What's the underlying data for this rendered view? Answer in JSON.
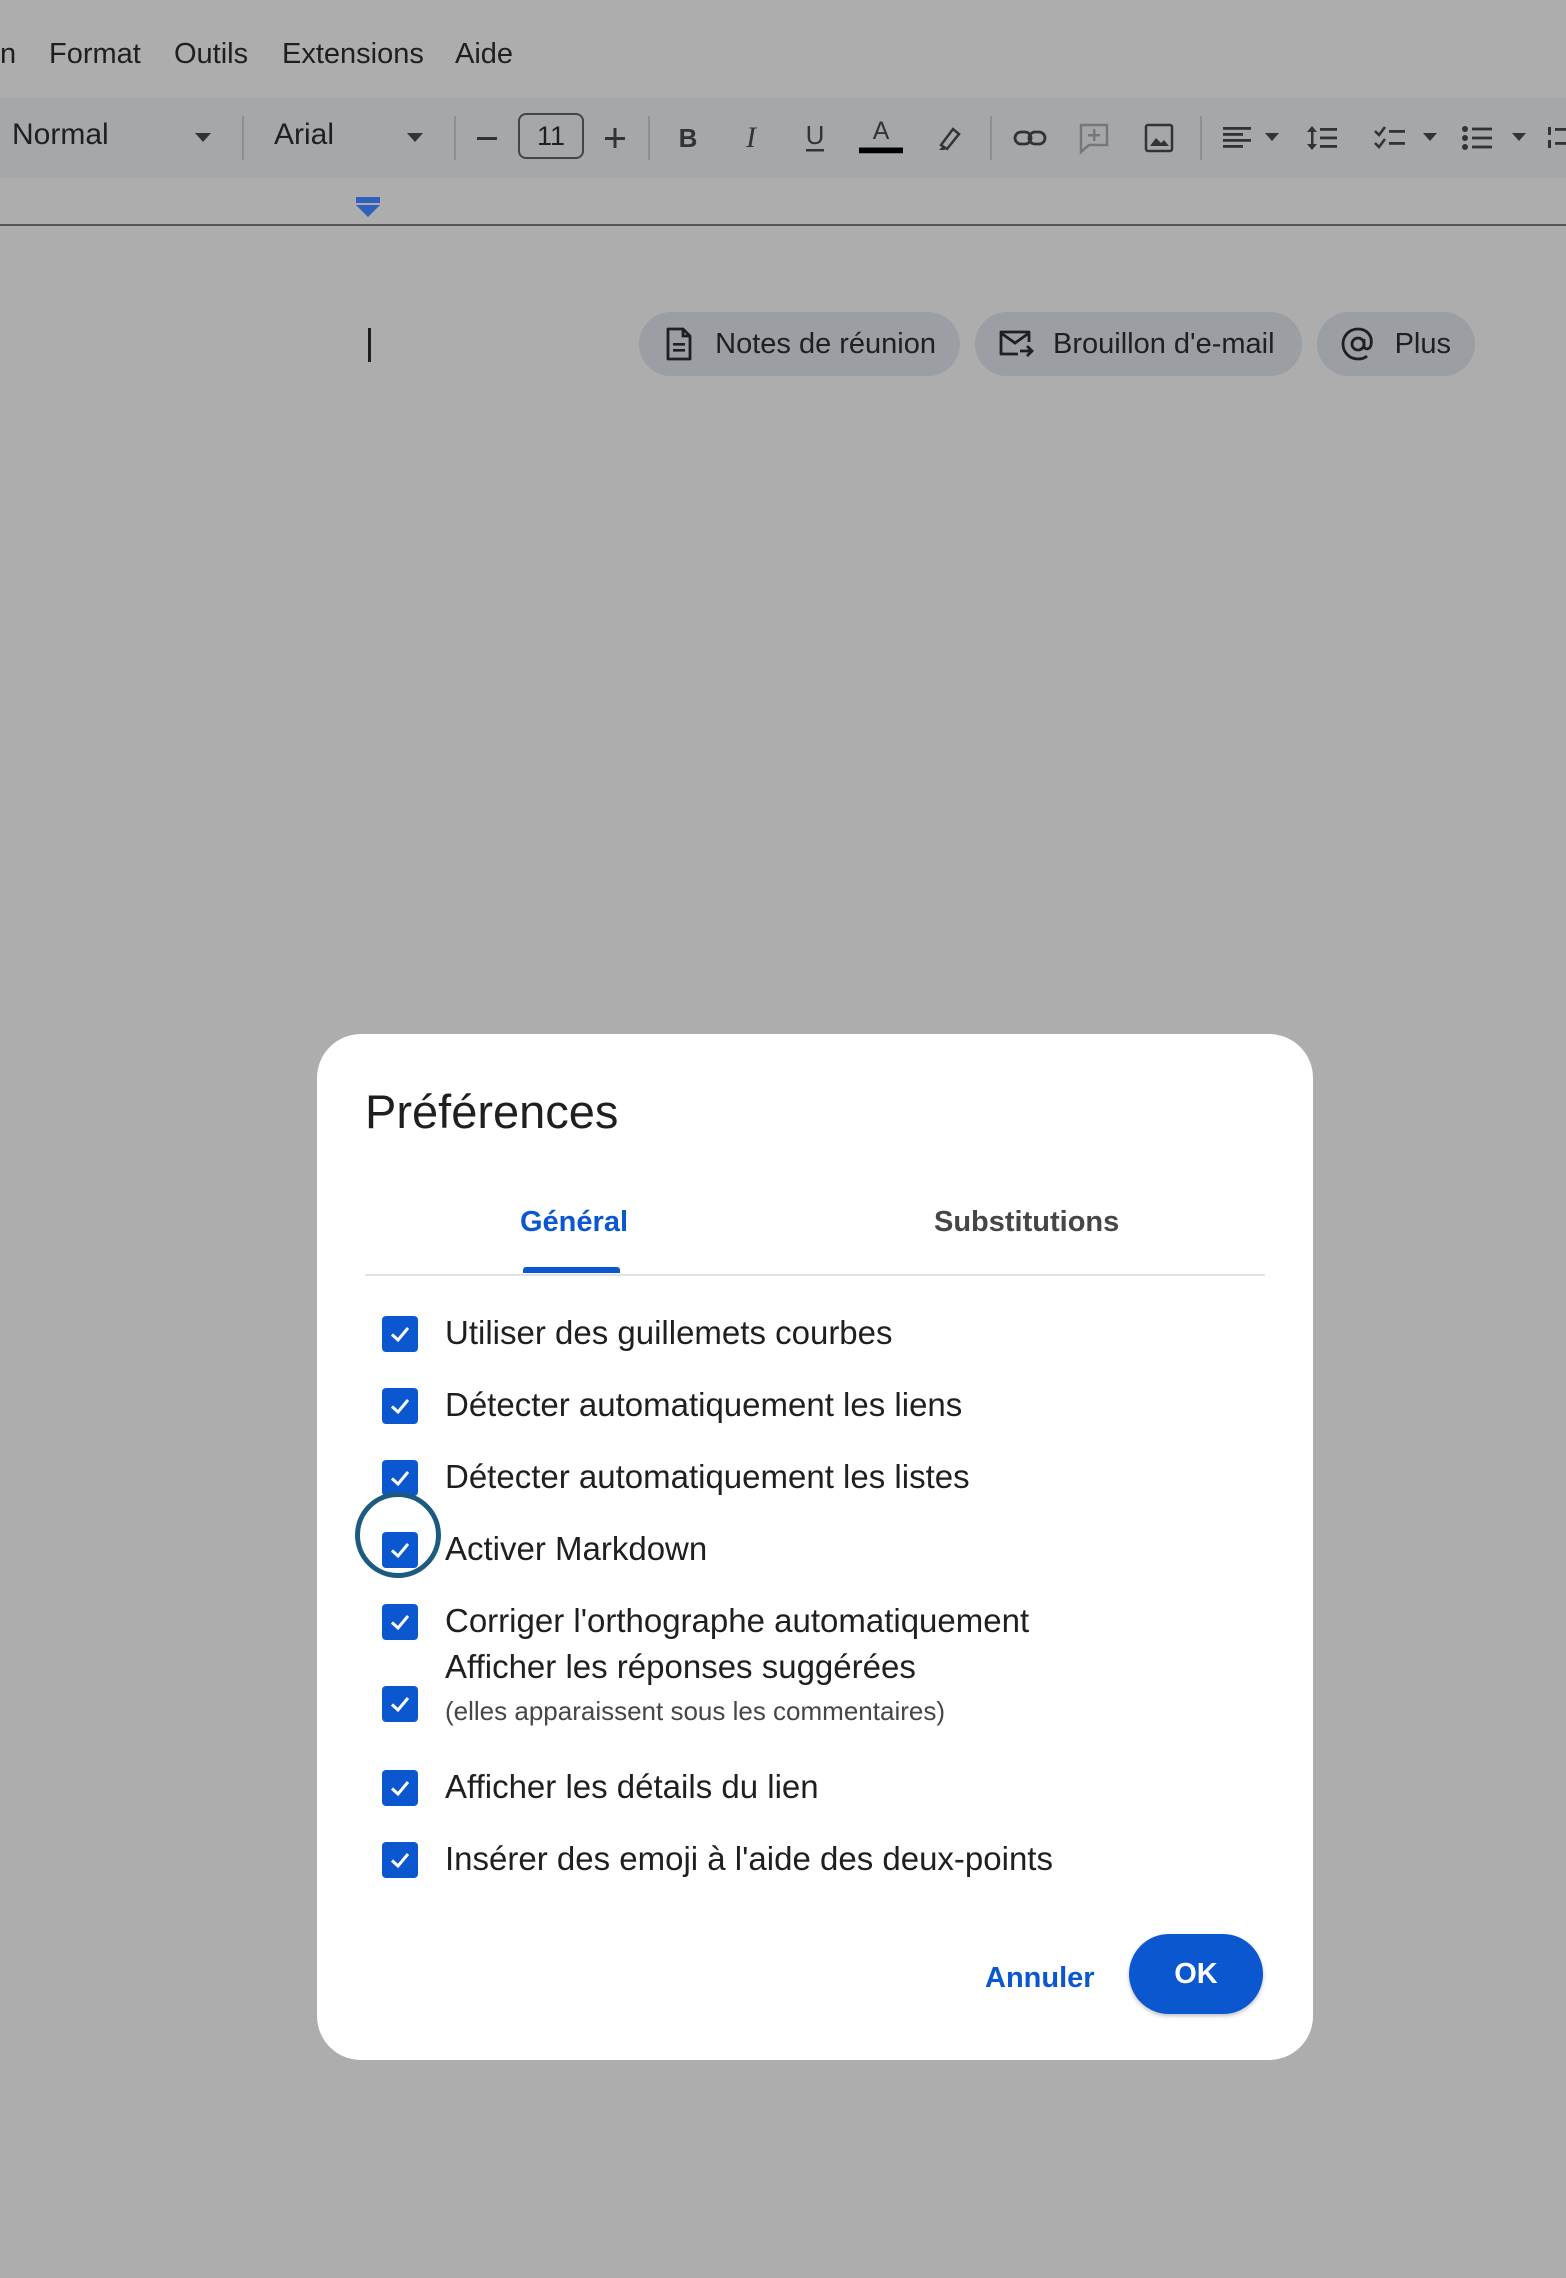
{
  "menu": {
    "items": [
      "n",
      "Format",
      "Outils",
      "Extensions",
      "Aide"
    ]
  },
  "toolbar": {
    "style": "Normal",
    "font": "Arial",
    "font_size": "11",
    "icons": [
      "decrease-font-size-icon",
      "increase-font-size-icon",
      "bold-icon",
      "italic-icon",
      "underline-icon",
      "text-color-icon",
      "highlight-icon",
      "link-icon",
      "add-comment-icon",
      "insert-image-icon",
      "align-icon",
      "line-spacing-icon",
      "checklist-icon",
      "bulleted-list-icon"
    ]
  },
  "document": {
    "chips": [
      {
        "label": "Notes de réunion",
        "icon": "document-icon"
      },
      {
        "label": "Brouillon d'e-mail",
        "icon": "email-draft-icon"
      },
      {
        "label": "Plus",
        "icon": "at-sign-icon"
      }
    ]
  },
  "dialog": {
    "title": "Préférences",
    "tabs": [
      {
        "label": "Général",
        "selected": true
      },
      {
        "label": "Substitutions",
        "selected": false
      }
    ],
    "options": [
      {
        "label": "Utiliser des guillemets courbes",
        "checked": true
      },
      {
        "label": "Détecter automatiquement les liens",
        "checked": true
      },
      {
        "label": "Détecter automatiquement les listes",
        "checked": true
      },
      {
        "label": "Activer Markdown",
        "checked": true
      },
      {
        "label": "Corriger l'orthographe automatiquement",
        "checked": true
      },
      {
        "label": "Afficher les réponses suggérées",
        "sublabel": "(elles apparaissent sous les commentaires)",
        "checked": true
      },
      {
        "label": "Afficher les détails du lien",
        "checked": true
      },
      {
        "label": "Insérer des emoji à l'aide des deux-points",
        "checked": true
      }
    ],
    "cancel_label": "Annuler",
    "ok_label": "OK"
  },
  "colors": {
    "accent": "#0b57d0",
    "overlay": "#adadad",
    "highlight_ring": "#1d5a80"
  }
}
